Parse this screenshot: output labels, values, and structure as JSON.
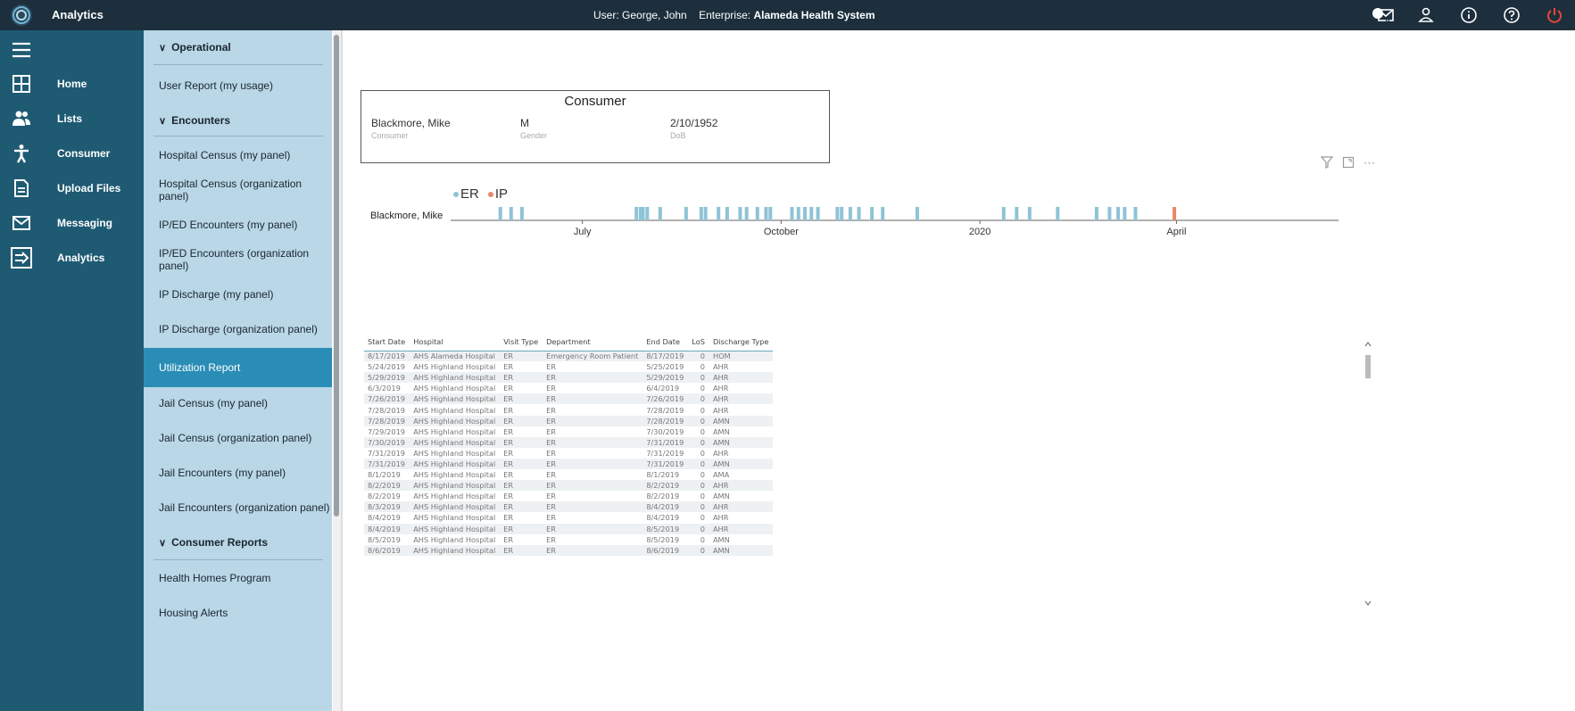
{
  "app": {
    "title": "Analytics"
  },
  "header": {
    "user_label": "User:",
    "user_name": "George, John",
    "enterprise_label": "Enterprise:",
    "enterprise_name": "Alameda Health System",
    "mail_badge": "0"
  },
  "sidebar": {
    "items": [
      {
        "label": "Home",
        "icon": "home-grid-icon"
      },
      {
        "label": "Lists",
        "icon": "people-icon"
      },
      {
        "label": "Consumer",
        "icon": "person-icon"
      },
      {
        "label": "Upload Files",
        "icon": "file-icon"
      },
      {
        "label": "Messaging",
        "icon": "mail-icon"
      },
      {
        "label": "Analytics",
        "icon": "analytics-arrow-icon"
      }
    ]
  },
  "nav": {
    "rows": [
      {
        "label": "Operational",
        "section": true
      },
      {
        "label": "User Report (my usage)"
      },
      {
        "label": "Encounters",
        "section": true
      },
      {
        "label": "Hospital Census (my panel)"
      },
      {
        "label": "Hospital Census (organization panel)"
      },
      {
        "label": "IP/ED Encounters (my panel)"
      },
      {
        "label": "IP/ED Encounters (organization panel)"
      },
      {
        "label": "IP Discharge (my panel)"
      },
      {
        "label": "IP Discharge (organization panel)"
      },
      {
        "label": "Utilization Report",
        "selected": true
      },
      {
        "label": "Jail Census (my panel)"
      },
      {
        "label": "Jail Census (organization panel)"
      },
      {
        "label": "Jail Encounters (my panel)"
      },
      {
        "label": "Jail Encounters (organization panel)"
      },
      {
        "label": "Consumer Reports",
        "section": true
      },
      {
        "label": "Health Homes Program"
      },
      {
        "label": "Housing Alerts"
      }
    ]
  },
  "consumer_card": {
    "title": "Consumer",
    "name": "Blackmore, Mike",
    "name_label": "Consumer",
    "gender": "M",
    "gender_label": "Gender",
    "dob": "2/10/1952",
    "dob_label": "DoB"
  },
  "colors": {
    "er": "#8fc3d6",
    "ip": "#e8896a",
    "accent": "#2a8db6"
  },
  "chart_data": {
    "type": "timeline",
    "legend": [
      "ER",
      "IP"
    ],
    "row_label": "Blackmore, Mike",
    "x_ticks": [
      "July",
      "October",
      "2020",
      "April"
    ],
    "x_range": [
      "2019-05-01",
      "2020-06-15"
    ],
    "tick_dates": [
      "2019-07-01",
      "2019-10-01",
      "2020-01-01",
      "2020-04-01"
    ],
    "events": [
      {
        "date": "2019-05-24",
        "type": "ER"
      },
      {
        "date": "2019-05-29",
        "type": "ER"
      },
      {
        "date": "2019-06-03",
        "type": "ER"
      },
      {
        "date": "2019-07-26",
        "type": "ER"
      },
      {
        "date": "2019-07-28",
        "type": "ER"
      },
      {
        "date": "2019-07-29",
        "type": "ER"
      },
      {
        "date": "2019-07-31",
        "type": "ER"
      },
      {
        "date": "2019-08-06",
        "type": "ER"
      },
      {
        "date": "2019-08-18",
        "type": "ER"
      },
      {
        "date": "2019-08-25",
        "type": "ER"
      },
      {
        "date": "2019-08-27",
        "type": "ER"
      },
      {
        "date": "2019-09-02",
        "type": "ER"
      },
      {
        "date": "2019-09-06",
        "type": "ER"
      },
      {
        "date": "2019-09-12",
        "type": "ER"
      },
      {
        "date": "2019-09-15",
        "type": "ER"
      },
      {
        "date": "2019-09-20",
        "type": "ER"
      },
      {
        "date": "2019-09-24",
        "type": "ER"
      },
      {
        "date": "2019-09-26",
        "type": "ER"
      },
      {
        "date": "2019-10-06",
        "type": "ER"
      },
      {
        "date": "2019-10-09",
        "type": "ER"
      },
      {
        "date": "2019-10-12",
        "type": "ER"
      },
      {
        "date": "2019-10-15",
        "type": "ER"
      },
      {
        "date": "2019-10-18",
        "type": "ER"
      },
      {
        "date": "2019-10-27",
        "type": "ER"
      },
      {
        "date": "2019-10-29",
        "type": "ER"
      },
      {
        "date": "2019-11-02",
        "type": "ER"
      },
      {
        "date": "2019-11-06",
        "type": "ER"
      },
      {
        "date": "2019-11-12",
        "type": "ER"
      },
      {
        "date": "2019-11-17",
        "type": "ER"
      },
      {
        "date": "2019-12-03",
        "type": "ER"
      },
      {
        "date": "2020-01-12",
        "type": "ER"
      },
      {
        "date": "2020-01-18",
        "type": "ER"
      },
      {
        "date": "2020-01-24",
        "type": "ER"
      },
      {
        "date": "2020-02-06",
        "type": "ER"
      },
      {
        "date": "2020-02-24",
        "type": "ER"
      },
      {
        "date": "2020-03-01",
        "type": "ER"
      },
      {
        "date": "2020-03-05",
        "type": "ER"
      },
      {
        "date": "2020-03-08",
        "type": "ER"
      },
      {
        "date": "2020-03-13",
        "type": "ER"
      },
      {
        "date": "2020-03-31",
        "type": "IP"
      }
    ]
  },
  "table": {
    "columns": [
      "Start Date",
      "Hospital",
      "Visit Type",
      "Department",
      "End Date",
      "LoS",
      "Discharge Type"
    ],
    "rows": [
      [
        "8/17/2019",
        "AHS Alameda Hospital",
        "ER",
        "Emergency Room Patient",
        "8/17/2019",
        "0",
        "HOM"
      ],
      [
        "5/24/2019",
        "AHS Highland Hospital",
        "ER",
        "ER",
        "5/25/2019",
        "0",
        "AHR"
      ],
      [
        "5/29/2019",
        "AHS Highland Hospital",
        "ER",
        "ER",
        "5/29/2019",
        "0",
        "AHR"
      ],
      [
        "6/3/2019",
        "AHS Highland Hospital",
        "ER",
        "ER",
        "6/4/2019",
        "0",
        "AHR"
      ],
      [
        "7/26/2019",
        "AHS Highland Hospital",
        "ER",
        "ER",
        "7/26/2019",
        "0",
        "AHR"
      ],
      [
        "7/28/2019",
        "AHS Highland Hospital",
        "ER",
        "ER",
        "7/28/2019",
        "0",
        "AHR"
      ],
      [
        "7/28/2019",
        "AHS Highland Hospital",
        "ER",
        "ER",
        "7/28/2019",
        "0",
        "AMN"
      ],
      [
        "7/29/2019",
        "AHS Highland Hospital",
        "ER",
        "ER",
        "7/30/2019",
        "0",
        "AMN"
      ],
      [
        "7/30/2019",
        "AHS Highland Hospital",
        "ER",
        "ER",
        "7/31/2019",
        "0",
        "AMN"
      ],
      [
        "7/31/2019",
        "AHS Highland Hospital",
        "ER",
        "ER",
        "7/31/2019",
        "0",
        "AHR"
      ],
      [
        "7/31/2019",
        "AHS Highland Hospital",
        "ER",
        "ER",
        "7/31/2019",
        "0",
        "AMN"
      ],
      [
        "8/1/2019",
        "AHS Highland Hospital",
        "ER",
        "ER",
        "8/1/2019",
        "0",
        "AMA"
      ],
      [
        "8/2/2019",
        "AHS Highland Hospital",
        "ER",
        "ER",
        "8/2/2019",
        "0",
        "AHR"
      ],
      [
        "8/2/2019",
        "AHS Highland Hospital",
        "ER",
        "ER",
        "8/2/2019",
        "0",
        "AMN"
      ],
      [
        "8/3/2019",
        "AHS Highland Hospital",
        "ER",
        "ER",
        "8/4/2019",
        "0",
        "AHR"
      ],
      [
        "8/4/2019",
        "AHS Highland Hospital",
        "ER",
        "ER",
        "8/4/2019",
        "0",
        "AHR"
      ],
      [
        "8/4/2019",
        "AHS Highland Hospital",
        "ER",
        "ER",
        "8/5/2019",
        "0",
        "AHR"
      ],
      [
        "8/5/2019",
        "AHS Highland Hospital",
        "ER",
        "ER",
        "8/5/2019",
        "0",
        "AMN"
      ],
      [
        "8/6/2019",
        "AHS Highland Hospital",
        "ER",
        "ER",
        "8/6/2019",
        "0",
        "AMN"
      ]
    ]
  }
}
